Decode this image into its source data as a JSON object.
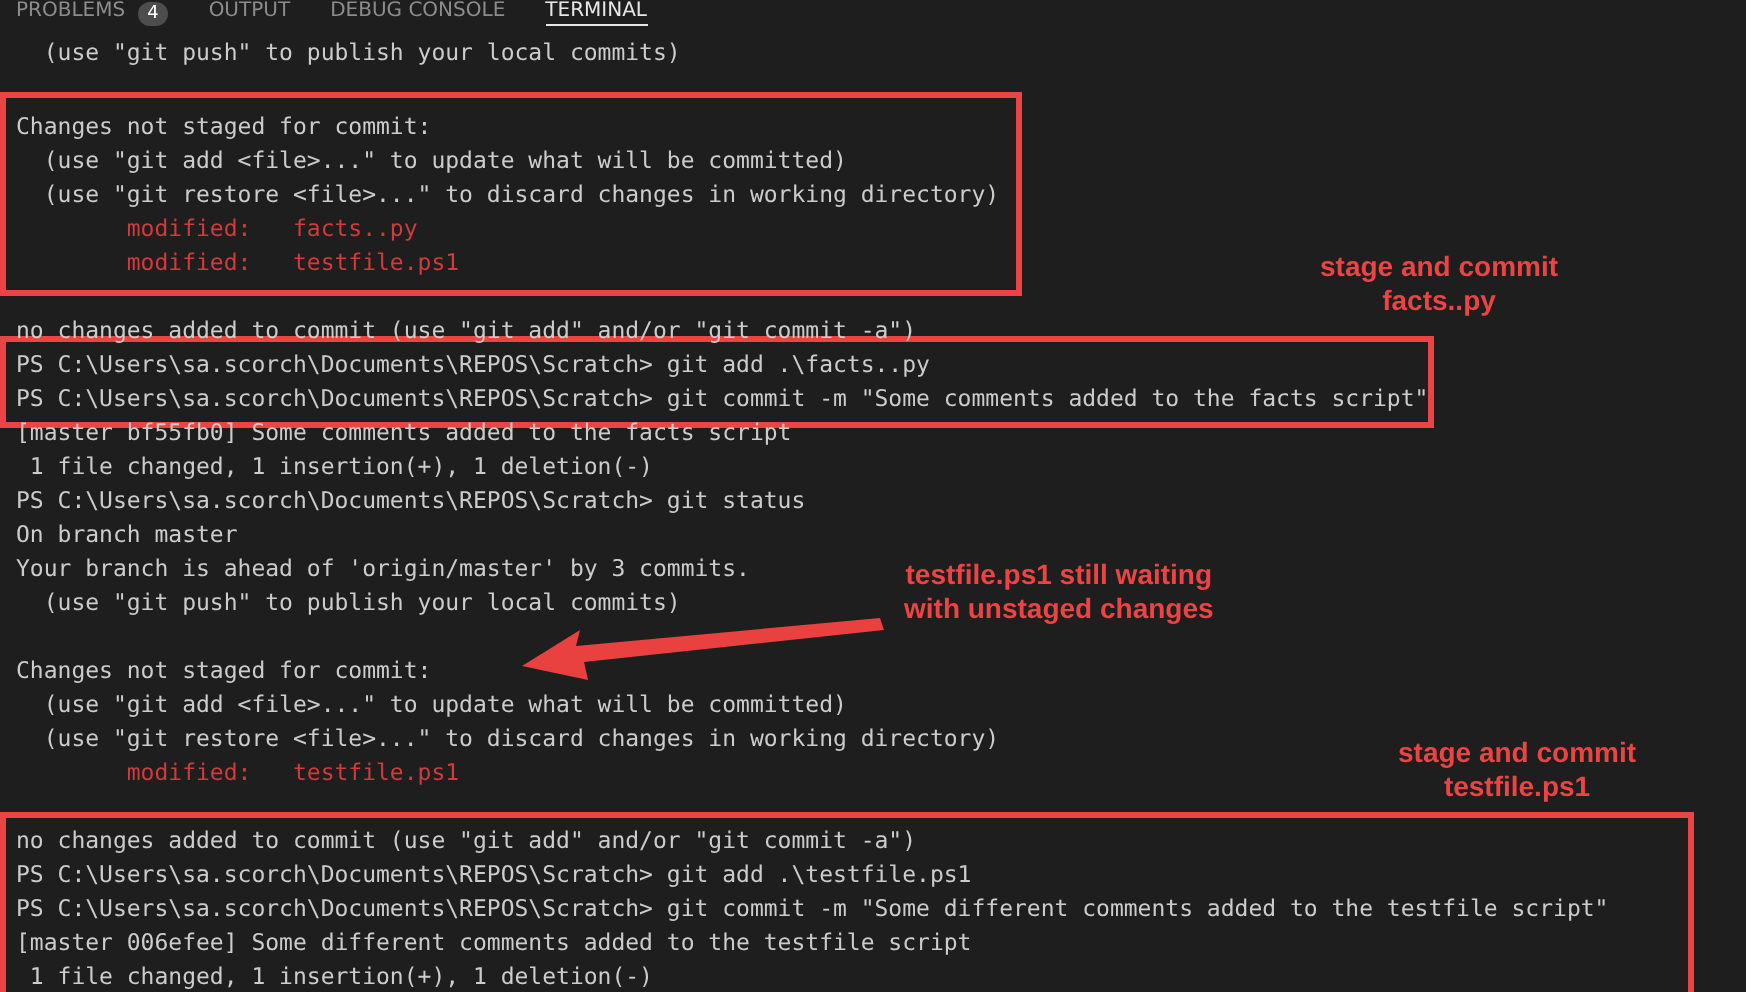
{
  "tabs": [
    {
      "label": "PROBLEMS",
      "badge": "4",
      "selected": false
    },
    {
      "label": "OUTPUT",
      "selected": false
    },
    {
      "label": "DEBUG CONSOLE",
      "selected": false
    },
    {
      "label": "TERMINAL",
      "selected": true
    }
  ],
  "terminal_blocks": [
    {
      "highlighted": false,
      "lines": [
        {
          "kind": "normal",
          "text": "  (use \"git push\" to publish your local commits)"
        },
        {
          "kind": "blank"
        }
      ]
    },
    {
      "highlighted": true,
      "lines": [
        {
          "kind": "normal",
          "text": "Changes not staged for commit:"
        },
        {
          "kind": "normal",
          "text": "  (use \"git add <file>...\" to update what will be committed)"
        },
        {
          "kind": "normal",
          "text": "  (use \"git restore <file>...\" to discard changes in working directory)"
        },
        {
          "kind": "modified",
          "text": "        modified:   facts..py"
        },
        {
          "kind": "modified",
          "text": "        modified:   testfile.ps1"
        }
      ]
    },
    {
      "highlighted": false,
      "lines": [
        {
          "kind": "blank"
        },
        {
          "kind": "normal",
          "text": "no changes added to commit (use \"git add\" and/or \"git commit -a\")"
        }
      ]
    },
    {
      "highlighted": true,
      "lines": [
        {
          "kind": "normal",
          "text": "PS C:\\Users\\sa.scorch\\Documents\\REPOS\\Scratch> git add .\\facts..py"
        },
        {
          "kind": "normal",
          "text": "PS C:\\Users\\sa.scorch\\Documents\\REPOS\\Scratch> git commit -m \"Some comments added to the facts script\""
        }
      ]
    },
    {
      "highlighted": false,
      "lines": [
        {
          "kind": "normal",
          "text": "[master bf55fb0] Some comments added to the facts script"
        },
        {
          "kind": "normal",
          "text": " 1 file changed, 1 insertion(+), 1 deletion(-)"
        },
        {
          "kind": "normal",
          "text": "PS C:\\Users\\sa.scorch\\Documents\\REPOS\\Scratch> git status"
        },
        {
          "kind": "normal",
          "text": "On branch master"
        },
        {
          "kind": "normal",
          "text": "Your branch is ahead of 'origin/master' by 3 commits."
        },
        {
          "kind": "normal",
          "text": "  (use \"git push\" to publish your local commits)"
        },
        {
          "kind": "blank"
        },
        {
          "kind": "normal",
          "text": "Changes not staged for commit:"
        },
        {
          "kind": "normal",
          "text": "  (use \"git add <file>...\" to update what will be committed)"
        },
        {
          "kind": "normal",
          "text": "  (use \"git restore <file>...\" to discard changes in working directory)"
        },
        {
          "kind": "modified",
          "text": "        modified:   testfile.ps1"
        },
        {
          "kind": "blank"
        }
      ]
    },
    {
      "highlighted": true,
      "lines": [
        {
          "kind": "normal",
          "text": "no changes added to commit (use \"git add\" and/or \"git commit -a\")"
        },
        {
          "kind": "normal",
          "text": "PS C:\\Users\\sa.scorch\\Documents\\REPOS\\Scratch> git add .\\testfile.ps1"
        },
        {
          "kind": "normal",
          "text": "PS C:\\Users\\sa.scorch\\Documents\\REPOS\\Scratch> git commit -m \"Some different comments added to the testfile script\""
        },
        {
          "kind": "normal",
          "text": "[master 006efee] Some different comments added to the testfile script"
        },
        {
          "kind": "normal",
          "text": " 1 file changed, 1 insertion(+), 1 deletion(-)"
        }
      ]
    }
  ],
  "annotations": [
    {
      "kind": "note",
      "text": "stage and commit\nfacts..py"
    },
    {
      "kind": "note",
      "text": "testfile.ps1 still waiting\nwith unstaged changes"
    },
    {
      "kind": "arrow"
    },
    {
      "kind": "note",
      "text": "stage and commit\ntestfile.ps1"
    }
  ]
}
